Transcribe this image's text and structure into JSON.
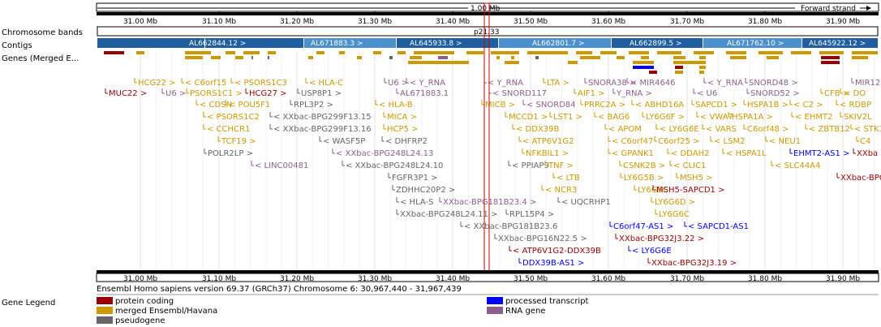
{
  "ruler": {
    "length_label": "1.00 Mb",
    "strand_label": "Forward strand"
  },
  "ticks": [
    "31.00 Mb",
    "31.10 Mb",
    "31.20 Mb",
    "31.30 Mb",
    "31.40 Mb",
    "31.50 Mb",
    "31.60 Mb",
    "31.70 Mb",
    "31.80 Mb",
    "31.90 Mb"
  ],
  "tracks": {
    "chromosome_bands": "Chromosome bands",
    "contigs": "Contigs",
    "genes": "Genes (Merged E..."
  },
  "band_label": "p21.33",
  "contigs": [
    "AL662844.12 >",
    "AL671883.3 >",
    "AL645933.8 >",
    "AL662801.7 >",
    "AL662899.5 >",
    "AL671762.10 >",
    "AL645922.12 >"
  ],
  "colors": {
    "protein_coding": "#990000",
    "merged": "#cc9900",
    "pseudogene": "#666666",
    "processed": "#0000ff",
    "rna": "#8c5e8c",
    "contig_dark": "#1f5fa0",
    "contig_light": "#4a90cc"
  },
  "genes": [
    {
      "text": "MUC22 >",
      "t": "pc"
    },
    {
      "text": "HCG22 >",
      "t": "m"
    },
    {
      "text": "< C6orf15",
      "t": "m"
    },
    {
      "text": "< PSORS1C3",
      "t": "m"
    },
    {
      "text": "HCG27 >",
      "t": "pc"
    },
    {
      "text": "U6 >",
      "t": "r"
    },
    {
      "text": "PSORS1C1 >",
      "t": "m"
    },
    {
      "text": "< CDSN",
      "t": "m"
    },
    {
      "text": "< POU5F1",
      "t": "m"
    },
    {
      "text": "< PSORS1C2",
      "t": "m"
    },
    {
      "text": "< CCHCR1",
      "t": "m"
    },
    {
      "text": "TCF19 >",
      "t": "m"
    },
    {
      "text": "POLR2LP >",
      "t": "p"
    },
    {
      "text": "< LINC00481",
      "t": "r"
    },
    {
      "text": "< HLA-C",
      "t": "m"
    },
    {
      "text": "USP8P1 >",
      "t": "p"
    },
    {
      "text": "RPL3P2 >",
      "t": "p"
    },
    {
      "text": "< HLA-B",
      "t": "m"
    },
    {
      "text": "< XXbac-BPG299F13.15",
      "t": "p"
    },
    {
      "text": "< XXbac-BPG299F13.16",
      "t": "p"
    },
    {
      "text": "< WASF5P",
      "t": "p"
    },
    {
      "text": "< XXbac-BPG248L24.13",
      "t": "r"
    },
    {
      "text": "< XXbac-BPG248L24.10",
      "t": "p"
    },
    {
      "text": "U6 >",
      "t": "r"
    },
    {
      "text": "< Y_RNA",
      "t": "r"
    },
    {
      "text": "AL671883.1",
      "t": "r"
    },
    {
      "text": "MICA >",
      "t": "m"
    },
    {
      "text": "HCP5 >",
      "t": "m"
    },
    {
      "text": "< DHFRP2",
      "t": "p"
    },
    {
      "text": "FGFR3P1 >",
      "t": "p"
    },
    {
      "text": "ZDHHC20P2 >",
      "t": "p"
    },
    {
      "text": "< HLA-S",
      "t": "p"
    },
    {
      "text": "XXbac-BPG181B23.4 >",
      "t": "r"
    },
    {
      "text": "XXbac-BPG248L24.11 >",
      "t": "p"
    },
    {
      "text": "< XXbac-BPG181B23.6",
      "t": "p"
    },
    {
      "text": "XXbac-BPG16N22.5 >",
      "t": "p"
    },
    {
      "text": "< Y_RNA",
      "t": "r"
    },
    {
      "text": "< SNORD117",
      "t": "r"
    },
    {
      "text": "MICB >",
      "t": "m"
    },
    {
      "text": "< SNORD84",
      "t": "r"
    },
    {
      "text": "MCCD1 >",
      "t": "m"
    },
    {
      "text": "< DDX39B",
      "t": "m"
    },
    {
      "text": "< ATP6V1G2",
      "t": "m"
    },
    {
      "text": "NFKBIL1 >",
      "t": "m"
    },
    {
      "text": "< PPIAP9",
      "t": "p"
    },
    {
      "text": "LTA >",
      "t": "m"
    },
    {
      "text": "AIF1 >",
      "t": "m"
    },
    {
      "text": "LST1 >",
      "t": "m"
    },
    {
      "text": "TNF >",
      "t": "m"
    },
    {
      "text": "< LTB",
      "t": "m"
    },
    {
      "text": "< NCR3",
      "t": "m"
    },
    {
      "text": "< UQCRHP1",
      "t": "p"
    },
    {
      "text": "RPL15P4 >",
      "t": "p"
    },
    {
      "text": "SNORA38 >",
      "t": "r"
    },
    {
      "text": "Y_RNA >",
      "t": "r"
    },
    {
      "text": "PRRC2A >",
      "t": "m"
    },
    {
      "text": "< BAG6",
      "t": "m"
    },
    {
      "text": "< APOM",
      "t": "m"
    },
    {
      "text": "< C6orf47",
      "t": "m"
    },
    {
      "text": "< GPANK1",
      "t": "m"
    },
    {
      "text": "CSNK2B >",
      "t": "m"
    },
    {
      "text": "LY6G5B >",
      "t": "m"
    },
    {
      "text": "LY6G5C",
      "t": "m"
    },
    {
      "text": "< MIR4646",
      "t": "r"
    },
    {
      "text": "< ABHD16A",
      "t": "m"
    },
    {
      "text": "LY6G6F >",
      "t": "m"
    },
    {
      "text": "< LY6G6E",
      "t": "m"
    },
    {
      "text": "C6orf25 >",
      "t": "m"
    },
    {
      "text": "< DDAH2",
      "t": "m"
    },
    {
      "text": "< CLIC1",
      "t": "m"
    },
    {
      "text": "MSH5 >",
      "t": "m"
    },
    {
      "text": "MSH5-SAPCD1 >",
      "t": "pc"
    },
    {
      "text": "LY6G6D >",
      "t": "m"
    },
    {
      "text": "LY6G6C",
      "t": "m"
    },
    {
      "text": "< Y_RNA",
      "t": "r"
    },
    {
      "text": "< U6",
      "t": "r"
    },
    {
      "text": "SAPCD1 >",
      "t": "m"
    },
    {
      "text": "< VWA7",
      "t": "m"
    },
    {
      "text": "< VARS",
      "t": "m"
    },
    {
      "text": "< LSM2",
      "t": "m"
    },
    {
      "text": "< HSPA1L",
      "t": "m"
    },
    {
      "text": "SNORD48 >",
      "t": "r"
    },
    {
      "text": "SNORD52 >",
      "t": "r"
    },
    {
      "text": "HSPA1B >",
      "t": "m"
    },
    {
      "text": "HSPA1A >",
      "t": "m"
    },
    {
      "text": "C6orf48 >",
      "t": "m"
    },
    {
      "text": "< NEU1",
      "t": "m"
    },
    {
      "text": "< SLC44A4",
      "t": "m"
    },
    {
      "text": "EHMT2-AS1 >",
      "t": "pt"
    },
    {
      "text": "< C2 >",
      "t": "m"
    },
    {
      "text": "< EHMT2",
      "t": "m"
    },
    {
      "text": "< ZBTB12",
      "t": "m"
    },
    {
      "text": "MIR12",
      "t": "r"
    },
    {
      "text": "CFB >",
      "t": "m"
    },
    {
      "text": "< DO",
      "t": "m"
    },
    {
      "text": "< RDBP",
      "t": "m"
    },
    {
      "text": "SKIV2L",
      "t": "m"
    },
    {
      "text": "< STK1",
      "t": "m"
    },
    {
      "text": "C4",
      "t": "m"
    },
    {
      "text": "XXba",
      "t": "pc"
    },
    {
      "text": "XXbac-BPG11",
      "t": "pc"
    },
    {
      "text": "C6orf47-AS1 >",
      "t": "pt"
    },
    {
      "text": "< SAPCD1-AS1",
      "t": "pt"
    },
    {
      "text": "XXbac-BPG32J3.22 >",
      "t": "pc"
    },
    {
      "text": "< LY6G6E",
      "t": "pt"
    },
    {
      "text": "< ATP6V1G2-DDX39B",
      "t": "pc"
    },
    {
      "text": "DDX39B-AS1 >",
      "t": "pt"
    },
    {
      "text": "XXbac-BPG32J3.19 >",
      "t": "pc"
    }
  ],
  "footer": {
    "description": "Ensembl Homo sapiens version 69.37 (GRCh37) Chromosome 6: 30,967,440 - 31,967,439"
  },
  "legend": {
    "title": "Gene Legend",
    "items": [
      {
        "label": "protein coding",
        "color": "#990000"
      },
      {
        "label": "merged Ensembl/Havana",
        "color": "#cc9900"
      },
      {
        "label": "pseudogene",
        "color": "#666666"
      },
      {
        "label": "processed transcript",
        "color": "#0000ff"
      },
      {
        "label": "RNA gene",
        "color": "#8c5e8c"
      }
    ]
  }
}
